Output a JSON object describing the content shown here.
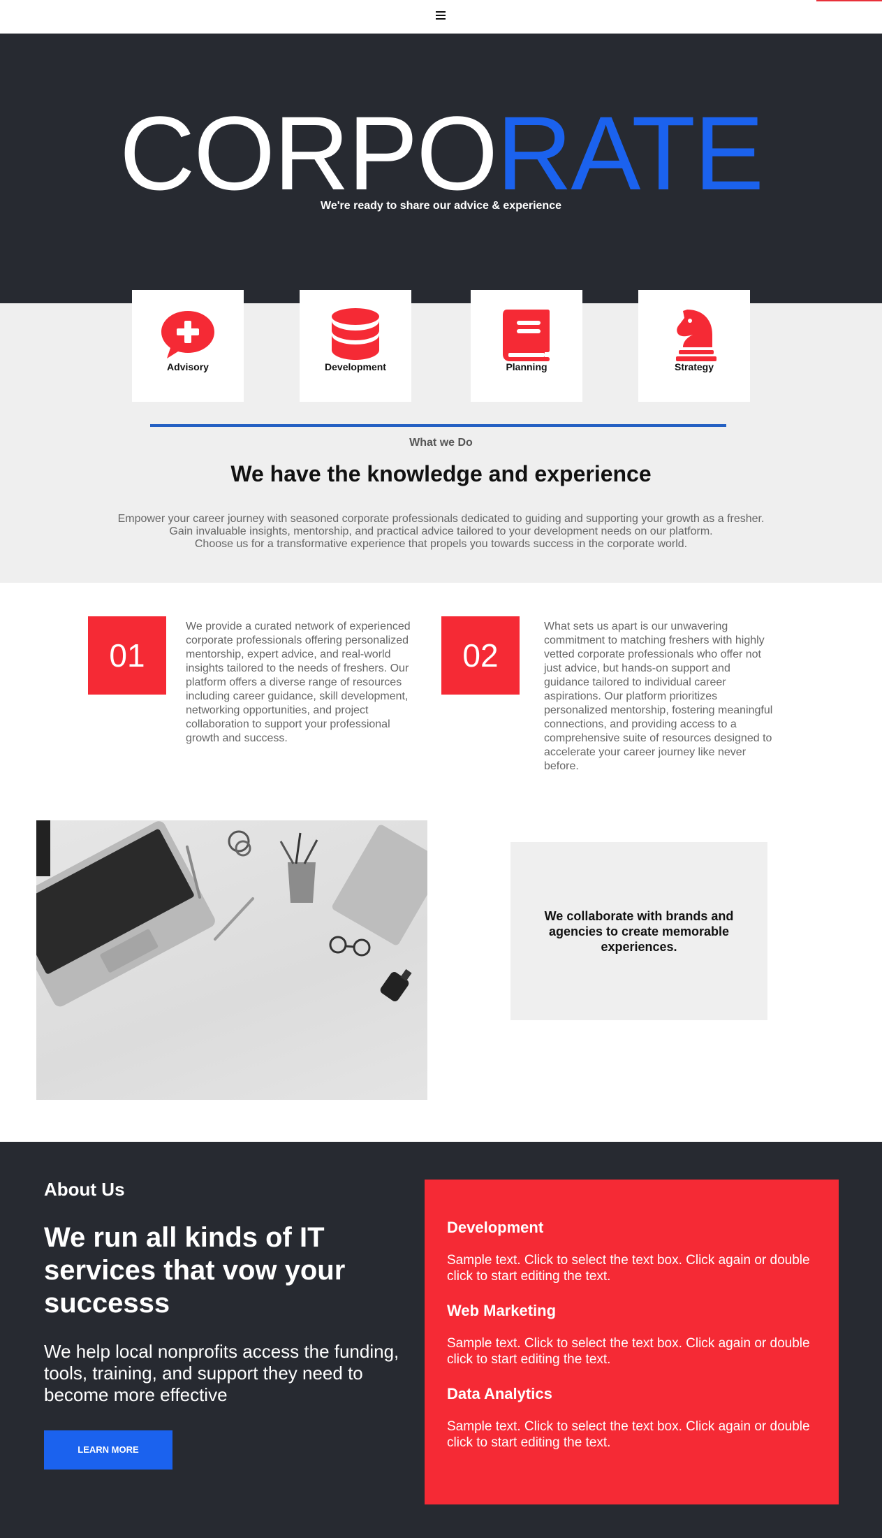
{
  "header": {
    "menu_icon": "hamburger-menu-icon"
  },
  "hero": {
    "title_part1": "CORPO",
    "title_part2": "RATE",
    "subtitle": "We're ready to share our advice & experience"
  },
  "services": [
    {
      "label": "Advisory",
      "icon": "speech-bubble-plus-icon"
    },
    {
      "label": "Development",
      "icon": "database-icon"
    },
    {
      "label": "Planning",
      "icon": "book-icon"
    },
    {
      "label": "Strategy",
      "icon": "chess-knight-icon"
    }
  ],
  "what_we_do": {
    "kicker": "What we Do",
    "heading": "We have the knowledge and experience",
    "lines": [
      "Empower your career journey with seasoned corporate professionals dedicated to guiding and supporting your growth as a fresher.",
      "Gain invaluable insights, mentorship, and practical advice tailored to your development needs on our platform.",
      "Choose us for a transformative experience that propels you towards success in the corporate world."
    ]
  },
  "features": [
    {
      "number": "01",
      "text": "We provide a curated network of experienced corporate professionals offering personalized mentorship, expert advice, and real-world insights tailored to the needs of freshers. Our platform offers a diverse range of resources including career guidance, skill development, networking opportunities, and project collaboration to support your professional growth and success."
    },
    {
      "number": "02",
      "text": "What sets us apart is our unwavering commitment to matching freshers with highly vetted corporate professionals who offer not just advice, but hands-on support and guidance tailored to individual career aspirations. Our platform prioritizes personalized mentorship, fostering meaningful connections, and providing access to a comprehensive suite of resources designed to accelerate your career journey like never before."
    }
  ],
  "collab": {
    "text": "We collaborate with brands and agencies to create memorable experiences."
  },
  "about": {
    "label": "About Us",
    "heading": "We run all kinds of IT services that vow your successs",
    "body": "We help local nonprofits access the funding, tools, training, and support they need to become more effective",
    "button": "LEARN MORE"
  },
  "service_list": [
    {
      "title": "Development",
      "text": "Sample text. Click to select the text box. Click again or double click to start editing the text."
    },
    {
      "title": "Web Marketing",
      "text": "Sample text. Click to select the text box. Click again or double click to start editing the text."
    },
    {
      "title": "Data Analytics",
      "text": "Sample text. Click to select the text box. Click again or double click to start editing the text."
    }
  ],
  "colors": {
    "dark": "#272a31",
    "brand_blue": "#1b62ee",
    "brand_red": "#f52a35",
    "light_grey": "#efefef"
  }
}
